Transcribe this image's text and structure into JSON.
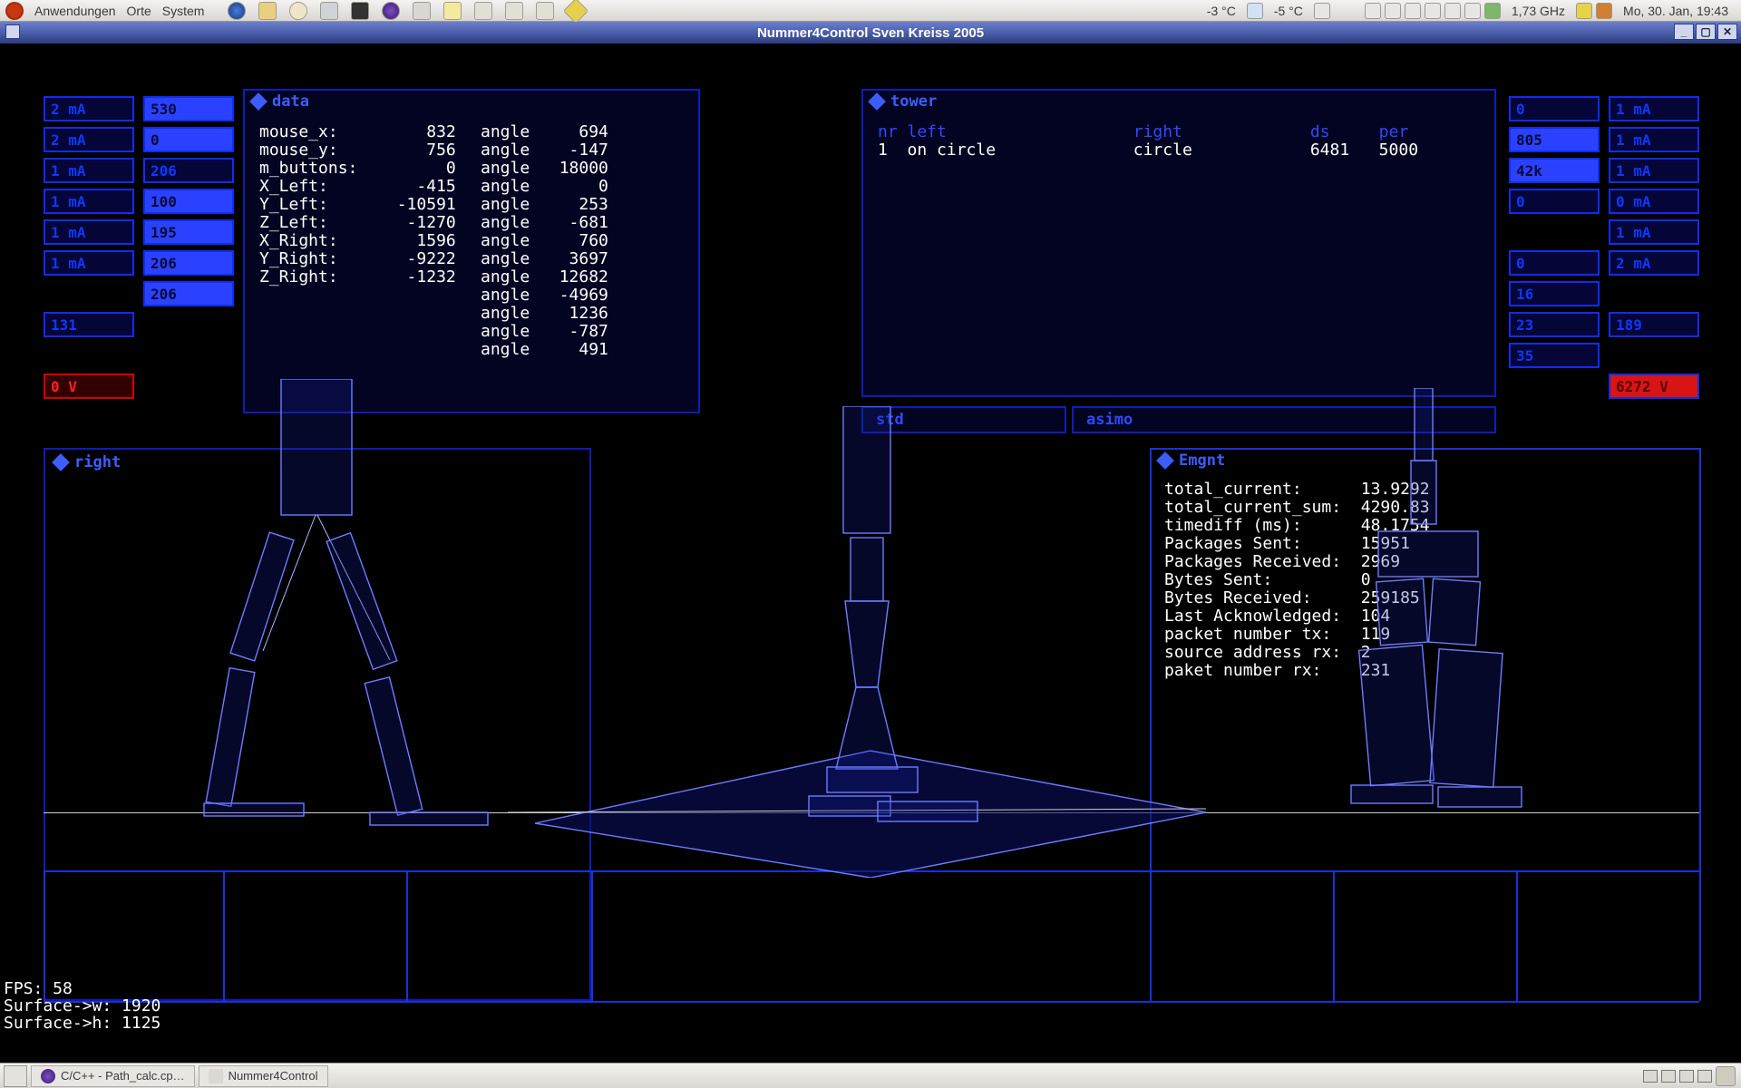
{
  "panel": {
    "menus": [
      "Anwendungen",
      "Orte",
      "System"
    ],
    "temp1": "-3 °C",
    "temp2": "-5 °C",
    "freq": "1,73 GHz",
    "clock": "Mo, 30. Jan, 19:43"
  },
  "titlebar": {
    "text": "Nummer4Control     Sven Kreiss 2005"
  },
  "leftMeters1": [
    "2 mA",
    "2 mA",
    "1 mA",
    "1 mA",
    "1 mA",
    "1 mA"
  ],
  "leftMeters1b": [
    "131"
  ],
  "leftMeters1c": [
    "0 V"
  ],
  "leftMeters2": [
    "530",
    "0",
    "206",
    "100",
    "195",
    "206",
    "206"
  ],
  "rightMeters1": [
    "0",
    "805",
    "42k",
    "0"
  ],
  "rightMeters1b": [
    "0",
    "16",
    "23",
    "35"
  ],
  "rightMeters2": [
    "1 mA",
    "1 mA",
    "1 mA",
    "0 mA",
    "1 mA",
    "2 mA"
  ],
  "rightMeters2b": [
    "189"
  ],
  "rightMeters2c": [
    "6272 V"
  ],
  "dataPanel": {
    "title": "data",
    "left": [
      [
        "mouse_x:",
        "832"
      ],
      [
        "mouse_y:",
        "756"
      ],
      [
        "m_buttons:",
        "0"
      ],
      [
        "X_Left:",
        "-415"
      ],
      [
        "Y_Left:",
        "-10591"
      ],
      [
        "Z_Left:",
        "-1270"
      ],
      [
        "X_Right:",
        "1596"
      ],
      [
        "Y_Right:",
        "-9222"
      ],
      [
        "Z_Right:",
        "-1232"
      ]
    ],
    "right": [
      [
        "angle",
        "694"
      ],
      [
        "angle",
        "-147"
      ],
      [
        "angle",
        "18000"
      ],
      [
        "angle",
        "0"
      ],
      [
        "angle",
        "253"
      ],
      [
        "angle",
        "-681"
      ],
      [
        "angle",
        "760"
      ],
      [
        "angle",
        "3697"
      ],
      [
        "angle",
        "12682"
      ],
      [
        "angle",
        "-4969"
      ],
      [
        "angle",
        "1236"
      ],
      [
        "angle",
        "-787"
      ],
      [
        "angle",
        "491"
      ]
    ]
  },
  "towerPanel": {
    "title": "tower",
    "hdr": [
      "nr",
      "left",
      "right",
      "ds",
      "per"
    ],
    "row": [
      "1",
      "on circle",
      "circle",
      "6481",
      "5000"
    ],
    "footerLeft": "std",
    "footerRight": "asimo"
  },
  "rightViewLabel": "right",
  "emgntPanel": {
    "title": "Emgnt",
    "rows": [
      [
        "total_current:",
        "13.9292"
      ],
      [
        "total_current_sum:",
        "4290.83"
      ],
      [
        "timediff (ms):",
        "48.1754"
      ],
      [
        "Packages Sent:",
        "15951"
      ],
      [
        "Packages Received:",
        "2969"
      ],
      [
        "Bytes Sent:",
        "0"
      ],
      [
        "Bytes Received:",
        "259185"
      ],
      [
        "Last Acknowledged:",
        "104"
      ],
      [
        "packet number tx:",
        "119"
      ],
      [
        "source address rx:",
        "2"
      ],
      [
        "paket number rx:",
        "231"
      ]
    ]
  },
  "fps": {
    "fps": "FPS: 58",
    "sw": "Surface->w: 1920",
    "sh": "Surface->h: 1125"
  },
  "taskbar": {
    "task1": "C/C++ - Path_calc.cp…",
    "task2": "Nummer4Control"
  }
}
